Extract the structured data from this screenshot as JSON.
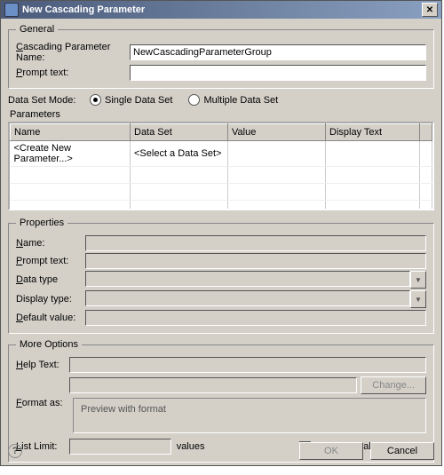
{
  "title": "New Cascading Parameter",
  "general": {
    "legend": "General",
    "name_label": "Cascading Parameter Name:",
    "name_value": "NewCascadingParameterGroup",
    "prompt_label": "Prompt text:",
    "prompt_value": ""
  },
  "dataset_mode": {
    "label": "Data Set Mode:",
    "single": "Single Data Set",
    "multiple": "Multiple Data Set",
    "selected": "single"
  },
  "parameters": {
    "label": "Parameters",
    "columns": {
      "name": "Name",
      "dataset": "Data Set",
      "value": "Value",
      "display": "Display Text"
    },
    "rows": [
      {
        "name": "<Create New Parameter...>",
        "dataset": "<Select a Data Set>",
        "value": "",
        "display": ""
      }
    ]
  },
  "properties": {
    "legend": "Properties",
    "name_label": "Name:",
    "prompt_label": "Prompt text:",
    "datatype_label": "Data type",
    "displaytype_label": "Display type:",
    "default_label": "Default value:"
  },
  "more": {
    "legend": "More Options",
    "help_label": "Help Text:",
    "change_btn": "Change...",
    "format_label": "Format as:",
    "preview_text": "Preview with format",
    "listlimit_label": "List Limit:",
    "values_label": "values",
    "allow_null": "Allow null value"
  },
  "buttons": {
    "ok": "OK",
    "cancel": "Cancel"
  }
}
